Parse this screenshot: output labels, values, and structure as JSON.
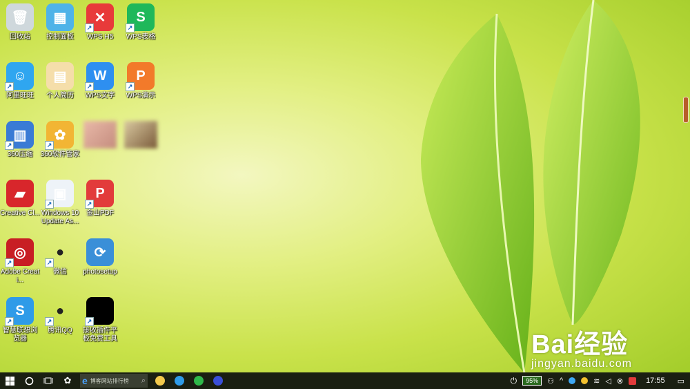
{
  "desktop": {
    "icons": [
      {
        "label": "回收站",
        "icon": "recycle-bin-icon",
        "color": "#cfd8dc",
        "glyph": "🗑",
        "shortcut": false
      },
      {
        "label": "控制面板",
        "icon": "control-panel-icon",
        "color": "#4fb3e8",
        "glyph": "▦",
        "shortcut": false
      },
      {
        "label": "WPS H5",
        "icon": "wps-h5-icon",
        "color": "#e83a3a",
        "glyph": "✕",
        "shortcut": true
      },
      {
        "label": "WPS表格",
        "icon": "wps-sheet-icon",
        "color": "#1fb85a",
        "glyph": "S",
        "shortcut": true
      },
      {
        "label": "阿里旺旺",
        "icon": "aliwangwang-icon",
        "color": "#2fa6f0",
        "glyph": "☺",
        "shortcut": true
      },
      {
        "label": "个人简历",
        "icon": "folder-icon",
        "color": "#f5deaa",
        "glyph": "▤",
        "shortcut": false
      },
      {
        "label": "WPS文字",
        "icon": "wps-writer-icon",
        "color": "#2e8ff0",
        "glyph": "W",
        "shortcut": true
      },
      {
        "label": "WPS演示",
        "icon": "wps-presentation-icon",
        "color": "#f27a2a",
        "glyph": "P",
        "shortcut": true
      },
      {
        "label": "360压缩",
        "icon": "360-zip-icon",
        "color": "#3a7bd5",
        "glyph": "▥",
        "shortcut": true
      },
      {
        "label": "360软件管家",
        "icon": "360-software-icon",
        "color": "#f2b534",
        "glyph": "✿",
        "shortcut": true
      },
      {
        "label": "Creative Cl...",
        "icon": "creative-cloud-icon",
        "color": "#d8262b",
        "glyph": "▰",
        "shortcut": false
      },
      {
        "label": "Windows 10 Update As...",
        "icon": "windows-update-icon",
        "color": "#eef3f8",
        "glyph": "▣",
        "shortcut": true
      },
      {
        "label": "金山PDF",
        "icon": "kingsoft-pdf-icon",
        "color": "#e23b3b",
        "glyph": "P",
        "shortcut": true
      },
      {
        "label": "Adobe Creati...",
        "icon": "adobe-cc-icon",
        "color": "#c81e24",
        "glyph": "◎",
        "shortcut": true
      },
      {
        "label": "微信",
        "icon": "wechat-icon",
        "color": "#ffffff",
        "glyph": "●",
        "shortcut": true
      },
      {
        "label": "photosetup",
        "icon": "photosetup-icon",
        "color": "#3a8fd8",
        "glyph": "⟳",
        "shortcut": false
      },
      {
        "label": "智慧联想浏览器",
        "icon": "browser-icon",
        "color": "#2f9be8",
        "glyph": "S",
        "shortcut": true
      },
      {
        "label": "腾讯QQ",
        "icon": "qq-icon",
        "color": "#ffffff",
        "glyph": "●",
        "shortcut": true
      },
      {
        "label": "接收插件平板免费工具",
        "icon": "black-app-icon",
        "color": "#000000",
        "glyph": "",
        "shortcut": true
      }
    ]
  },
  "taskbar": {
    "search_placeholder": "博客网站排行榜",
    "battery_percent": "95%",
    "clock": "17:55",
    "apps": [
      {
        "name": "file-explorer-icon",
        "color": "#f2c94c"
      },
      {
        "name": "lenovo-browser-icon",
        "color": "#2f9be8"
      },
      {
        "name": "360-browser-icon",
        "color": "#2fb84a"
      },
      {
        "name": "baidu-app-icon",
        "color": "#3a4fd8"
      }
    ]
  },
  "watermark": {
    "main": "Bai经验",
    "sub": "jingyan.baidu.com"
  }
}
